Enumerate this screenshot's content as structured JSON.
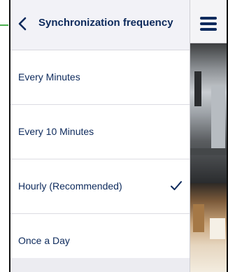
{
  "panel": {
    "title": "Synchronization frequency",
    "back_icon": "chevron-left-icon",
    "options": [
      {
        "label": "Every Minutes",
        "selected": false
      },
      {
        "label": "Every 10 Minutes",
        "selected": false
      },
      {
        "label": "Hourly (Recommended)",
        "selected": true
      },
      {
        "label": "Once a Day",
        "selected": false
      }
    ],
    "check_icon": "checkmark-icon"
  },
  "app": {
    "menu_icon": "hamburger-menu-icon"
  },
  "colors": {
    "accent": "#0d2a5c",
    "panel_bg": "#f2f2f7",
    "row_bg": "#ffffff",
    "guide": "#4caf50"
  }
}
